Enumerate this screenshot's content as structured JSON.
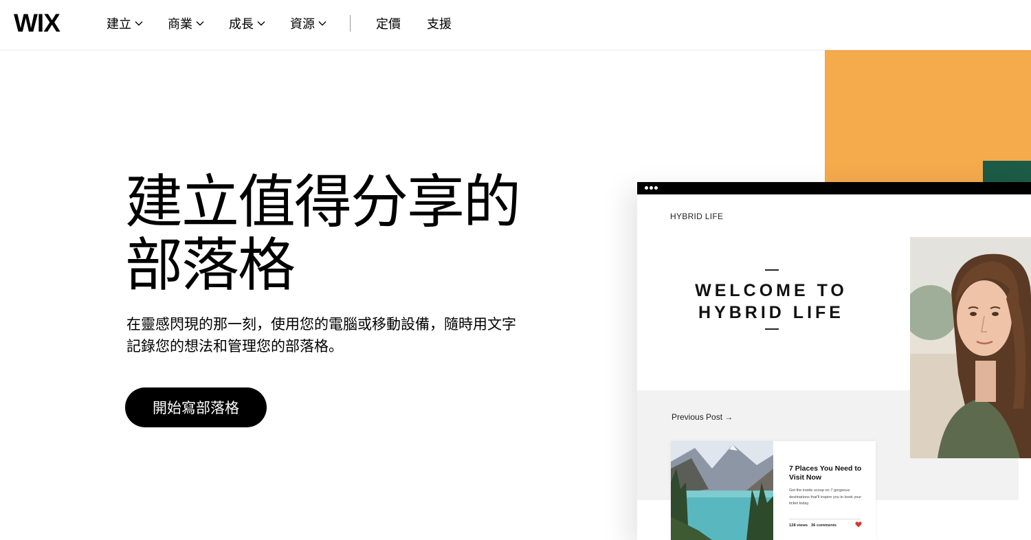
{
  "header": {
    "logo": "WIX",
    "nav": [
      {
        "label": "建立",
        "has_dropdown": true
      },
      {
        "label": "商業",
        "has_dropdown": true
      },
      {
        "label": "成長",
        "has_dropdown": true
      },
      {
        "label": "資源",
        "has_dropdown": true
      }
    ],
    "links": [
      "定價",
      "支援"
    ]
  },
  "hero": {
    "title_line1": "建立值得分享的",
    "title_line2": "部落格",
    "description_line1": "在靈感閃現的那一刻，使用您的電腦或移動設備，隨時用文字",
    "description_line2": "記錄您的想法和管理您的部落格。",
    "cta": "開始寫部落格"
  },
  "preview": {
    "site_name": "HYBRID LIFE",
    "welcome_line1": "WELCOME TO",
    "welcome_line2": "HYBRID LIFE",
    "previous_post": "Previous Post →",
    "card": {
      "title": "7 Places You Need to Visit Now",
      "excerpt": "Get the inside scoop on 7 gorgeous destinations that'll inspire you to book your ticket today.",
      "views": "128 views",
      "comments": "36 comments"
    }
  },
  "colors": {
    "accent_orange": "#f5aa4c",
    "accent_green": "#1c5b46",
    "heart": "#d9352c"
  }
}
